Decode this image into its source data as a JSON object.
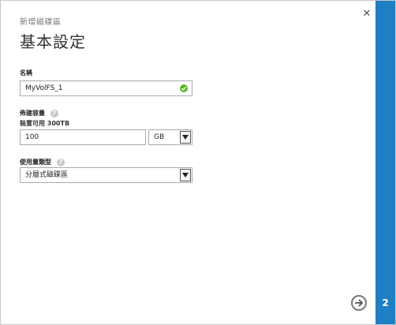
{
  "wizard": {
    "subtitle": "新增磁碟區",
    "title": "基本設定",
    "step": "2"
  },
  "form": {
    "name": {
      "label": "名稱",
      "value": "MyVolFS_1",
      "status": "valid"
    },
    "capacity": {
      "label": "佈建容量",
      "available": "裝置可用 300TB",
      "value": "100",
      "unit": "GB"
    },
    "usage_type": {
      "label": "使用量類型",
      "value": "分層式磁碟區"
    }
  },
  "colors": {
    "accent": "#1f7fc4",
    "valid": "#5ab52a"
  }
}
